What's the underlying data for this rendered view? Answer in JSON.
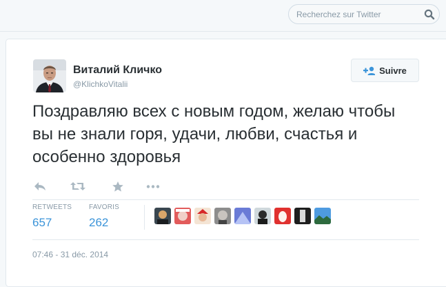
{
  "search": {
    "placeholder": "Recherchez sur Twitter"
  },
  "icons": {
    "search": "search-icon",
    "follow": "add-user-icon",
    "reply": "reply-icon",
    "retweet": "retweet-icon",
    "favorite": "star-icon",
    "more": "more-icon"
  },
  "tweet": {
    "author": {
      "name": "Виталий Кличко",
      "handle": "@KlichkoVitalii"
    },
    "follow_label": "Suivre",
    "text": "Поздравляю всех с новым годом, желаю чтобы вы не знали горя, удачи, любви, счастья и особенно здоровья",
    "stats": {
      "retweets_label": "RETWEETS",
      "retweets_value": "657",
      "favorites_label": "FAVORIS",
      "favorites_value": "262"
    },
    "favoriters_count_shown": 9,
    "timestamp": "07:46 - 31 déc. 2014"
  },
  "colors": {
    "accent": "#3b94d9",
    "text": "#292f33",
    "muted": "#8899a6",
    "border": "#e1e8ed"
  }
}
